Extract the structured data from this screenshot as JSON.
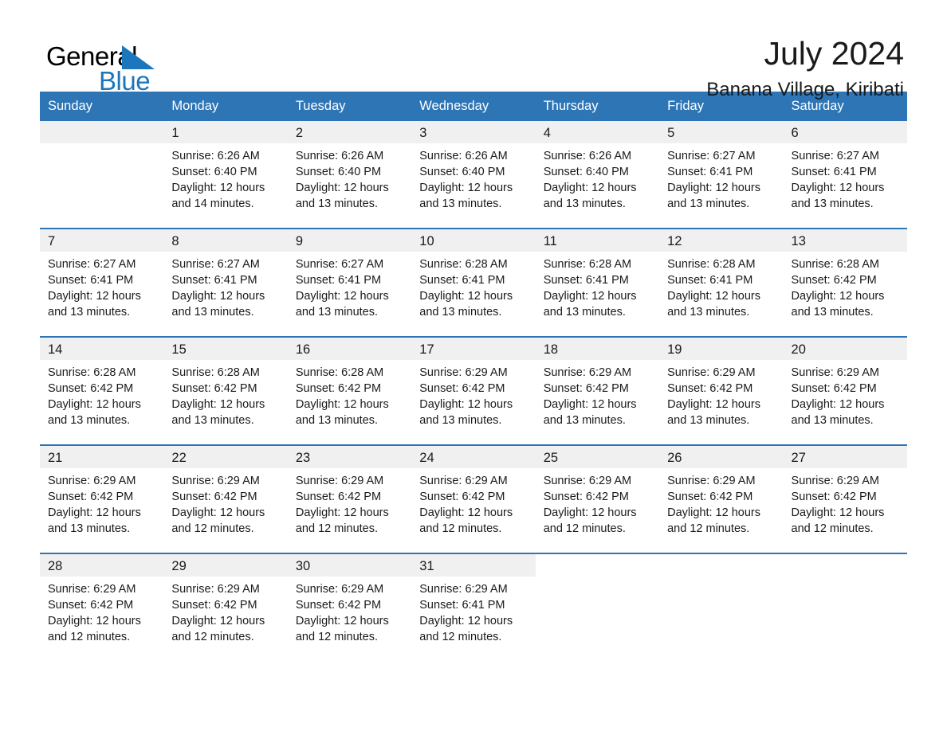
{
  "brand": {
    "name_part1": "General",
    "name_part2": "Blue",
    "triangle_color": "#1b76bc",
    "text_color": "#000000"
  },
  "header": {
    "month_title": "July 2024",
    "location": "Banana Village, Kiribati"
  },
  "colors": {
    "header_blue": "#2e75b6",
    "row_divider_blue": "#2e75b6",
    "daynum_band": "#f0f0f0",
    "text": "#1a1a1a"
  },
  "weekday_headers": [
    "Sunday",
    "Monday",
    "Tuesday",
    "Wednesday",
    "Thursday",
    "Friday",
    "Saturday"
  ],
  "labels": {
    "sunrise_prefix": "Sunrise:",
    "sunset_prefix": "Sunset:",
    "daylight_prefix": "Daylight:"
  },
  "weeks": [
    [
      {
        "day": "",
        "empty": true
      },
      {
        "day": "1",
        "sunrise": "Sunrise: 6:26 AM",
        "sunset": "Sunset: 6:40 PM",
        "daylight_l1": "Daylight: 12 hours",
        "daylight_l2": "and 14 minutes."
      },
      {
        "day": "2",
        "sunrise": "Sunrise: 6:26 AM",
        "sunset": "Sunset: 6:40 PM",
        "daylight_l1": "Daylight: 12 hours",
        "daylight_l2": "and 13 minutes."
      },
      {
        "day": "3",
        "sunrise": "Sunrise: 6:26 AM",
        "sunset": "Sunset: 6:40 PM",
        "daylight_l1": "Daylight: 12 hours",
        "daylight_l2": "and 13 minutes."
      },
      {
        "day": "4",
        "sunrise": "Sunrise: 6:26 AM",
        "sunset": "Sunset: 6:40 PM",
        "daylight_l1": "Daylight: 12 hours",
        "daylight_l2": "and 13 minutes."
      },
      {
        "day": "5",
        "sunrise": "Sunrise: 6:27 AM",
        "sunset": "Sunset: 6:41 PM",
        "daylight_l1": "Daylight: 12 hours",
        "daylight_l2": "and 13 minutes."
      },
      {
        "day": "6",
        "sunrise": "Sunrise: 6:27 AM",
        "sunset": "Sunset: 6:41 PM",
        "daylight_l1": "Daylight: 12 hours",
        "daylight_l2": "and 13 minutes."
      }
    ],
    [
      {
        "day": "7",
        "sunrise": "Sunrise: 6:27 AM",
        "sunset": "Sunset: 6:41 PM",
        "daylight_l1": "Daylight: 12 hours",
        "daylight_l2": "and 13 minutes."
      },
      {
        "day": "8",
        "sunrise": "Sunrise: 6:27 AM",
        "sunset": "Sunset: 6:41 PM",
        "daylight_l1": "Daylight: 12 hours",
        "daylight_l2": "and 13 minutes."
      },
      {
        "day": "9",
        "sunrise": "Sunrise: 6:27 AM",
        "sunset": "Sunset: 6:41 PM",
        "daylight_l1": "Daylight: 12 hours",
        "daylight_l2": "and 13 minutes."
      },
      {
        "day": "10",
        "sunrise": "Sunrise: 6:28 AM",
        "sunset": "Sunset: 6:41 PM",
        "daylight_l1": "Daylight: 12 hours",
        "daylight_l2": "and 13 minutes."
      },
      {
        "day": "11",
        "sunrise": "Sunrise: 6:28 AM",
        "sunset": "Sunset: 6:41 PM",
        "daylight_l1": "Daylight: 12 hours",
        "daylight_l2": "and 13 minutes."
      },
      {
        "day": "12",
        "sunrise": "Sunrise: 6:28 AM",
        "sunset": "Sunset: 6:41 PM",
        "daylight_l1": "Daylight: 12 hours",
        "daylight_l2": "and 13 minutes."
      },
      {
        "day": "13",
        "sunrise": "Sunrise: 6:28 AM",
        "sunset": "Sunset: 6:42 PM",
        "daylight_l1": "Daylight: 12 hours",
        "daylight_l2": "and 13 minutes."
      }
    ],
    [
      {
        "day": "14",
        "sunrise": "Sunrise: 6:28 AM",
        "sunset": "Sunset: 6:42 PM",
        "daylight_l1": "Daylight: 12 hours",
        "daylight_l2": "and 13 minutes."
      },
      {
        "day": "15",
        "sunrise": "Sunrise: 6:28 AM",
        "sunset": "Sunset: 6:42 PM",
        "daylight_l1": "Daylight: 12 hours",
        "daylight_l2": "and 13 minutes."
      },
      {
        "day": "16",
        "sunrise": "Sunrise: 6:28 AM",
        "sunset": "Sunset: 6:42 PM",
        "daylight_l1": "Daylight: 12 hours",
        "daylight_l2": "and 13 minutes."
      },
      {
        "day": "17",
        "sunrise": "Sunrise: 6:29 AM",
        "sunset": "Sunset: 6:42 PM",
        "daylight_l1": "Daylight: 12 hours",
        "daylight_l2": "and 13 minutes."
      },
      {
        "day": "18",
        "sunrise": "Sunrise: 6:29 AM",
        "sunset": "Sunset: 6:42 PM",
        "daylight_l1": "Daylight: 12 hours",
        "daylight_l2": "and 13 minutes."
      },
      {
        "day": "19",
        "sunrise": "Sunrise: 6:29 AM",
        "sunset": "Sunset: 6:42 PM",
        "daylight_l1": "Daylight: 12 hours",
        "daylight_l2": "and 13 minutes."
      },
      {
        "day": "20",
        "sunrise": "Sunrise: 6:29 AM",
        "sunset": "Sunset: 6:42 PM",
        "daylight_l1": "Daylight: 12 hours",
        "daylight_l2": "and 13 minutes."
      }
    ],
    [
      {
        "day": "21",
        "sunrise": "Sunrise: 6:29 AM",
        "sunset": "Sunset: 6:42 PM",
        "daylight_l1": "Daylight: 12 hours",
        "daylight_l2": "and 13 minutes."
      },
      {
        "day": "22",
        "sunrise": "Sunrise: 6:29 AM",
        "sunset": "Sunset: 6:42 PM",
        "daylight_l1": "Daylight: 12 hours",
        "daylight_l2": "and 12 minutes."
      },
      {
        "day": "23",
        "sunrise": "Sunrise: 6:29 AM",
        "sunset": "Sunset: 6:42 PM",
        "daylight_l1": "Daylight: 12 hours",
        "daylight_l2": "and 12 minutes."
      },
      {
        "day": "24",
        "sunrise": "Sunrise: 6:29 AM",
        "sunset": "Sunset: 6:42 PM",
        "daylight_l1": "Daylight: 12 hours",
        "daylight_l2": "and 12 minutes."
      },
      {
        "day": "25",
        "sunrise": "Sunrise: 6:29 AM",
        "sunset": "Sunset: 6:42 PM",
        "daylight_l1": "Daylight: 12 hours",
        "daylight_l2": "and 12 minutes."
      },
      {
        "day": "26",
        "sunrise": "Sunrise: 6:29 AM",
        "sunset": "Sunset: 6:42 PM",
        "daylight_l1": "Daylight: 12 hours",
        "daylight_l2": "and 12 minutes."
      },
      {
        "day": "27",
        "sunrise": "Sunrise: 6:29 AM",
        "sunset": "Sunset: 6:42 PM",
        "daylight_l1": "Daylight: 12 hours",
        "daylight_l2": "and 12 minutes."
      }
    ],
    [
      {
        "day": "28",
        "sunrise": "Sunrise: 6:29 AM",
        "sunset": "Sunset: 6:42 PM",
        "daylight_l1": "Daylight: 12 hours",
        "daylight_l2": "and 12 minutes."
      },
      {
        "day": "29",
        "sunrise": "Sunrise: 6:29 AM",
        "sunset": "Sunset: 6:42 PM",
        "daylight_l1": "Daylight: 12 hours",
        "daylight_l2": "and 12 minutes."
      },
      {
        "day": "30",
        "sunrise": "Sunrise: 6:29 AM",
        "sunset": "Sunset: 6:42 PM",
        "daylight_l1": "Daylight: 12 hours",
        "daylight_l2": "and 12 minutes."
      },
      {
        "day": "31",
        "sunrise": "Sunrise: 6:29 AM",
        "sunset": "Sunset: 6:41 PM",
        "daylight_l1": "Daylight: 12 hours",
        "daylight_l2": "and 12 minutes."
      },
      {
        "day": "",
        "blank": true
      },
      {
        "day": "",
        "blank": true
      },
      {
        "day": "",
        "blank": true
      }
    ]
  ]
}
